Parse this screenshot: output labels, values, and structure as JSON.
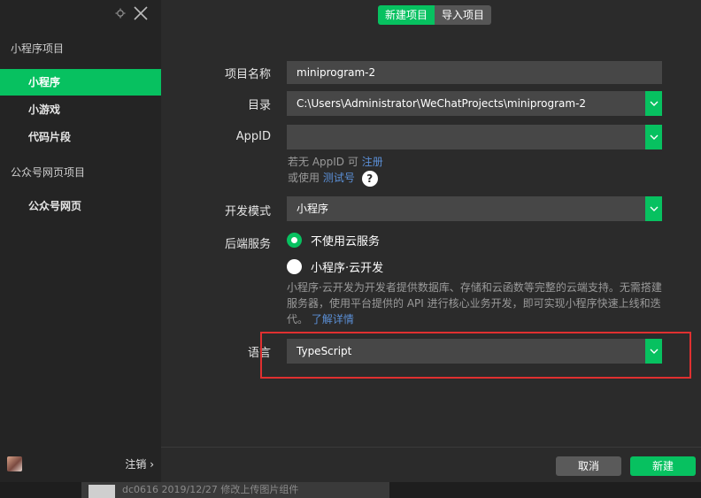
{
  "sidebar": {
    "group1": "小程序项目",
    "items1": [
      {
        "label": "小程序"
      },
      {
        "label": "小游戏"
      },
      {
        "label": "代码片段"
      }
    ],
    "group2": "公众号网页项目",
    "items2": [
      {
        "label": "公众号网页"
      }
    ],
    "logout": "注销 ›"
  },
  "tabs": [
    {
      "label": "新建项目",
      "active": true
    },
    {
      "label": "导入项目",
      "active": false
    }
  ],
  "form": {
    "name_label": "项目名称",
    "name_value": "miniprogram-2",
    "dir_label": "目录",
    "dir_value": "C:\\Users\\Administrator\\WeChatProjects\\miniprogram-2",
    "appid_label": "AppID",
    "appid_value": "",
    "appid_hint_prefix": "若无 AppID 可",
    "appid_hint_link": "注册",
    "appid_hint2_prefix": "或使用",
    "appid_hint2_link": "测试号",
    "help": "?",
    "mode_label": "开发模式",
    "mode_value": "小程序",
    "backend_label": "后端服务",
    "backend_opt1": "不使用云服务",
    "backend_opt2": "小程序·云开发",
    "backend_desc": "小程序·云开发为开发者提供数据库、存储和云函数等完整的云端支持。无需搭建服务器，使用平台提供的 API 进行核心业务开发，即可实现小程序快速上线和迭代。",
    "backend_link": "了解详情",
    "lang_label": "语言",
    "lang_value": "TypeScript"
  },
  "buttons": {
    "cancel": "取消",
    "create": "新建"
  },
  "background_text": "dc0616 2019/12/27 修改上传图片组件",
  "colors": {
    "accent": "#07c160",
    "highlight": "#e03030"
  }
}
